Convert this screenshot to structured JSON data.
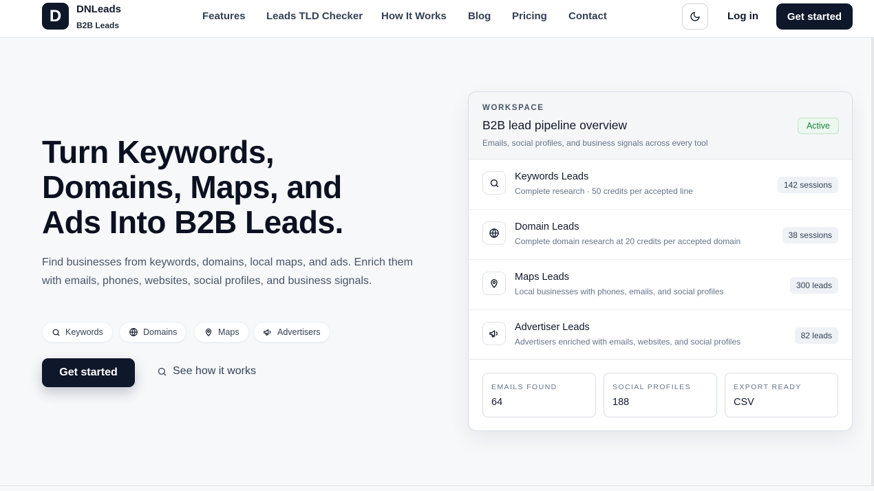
{
  "brand": {
    "logo_letter": "D",
    "name": "DNLeads",
    "tagline": "B2B Leads"
  },
  "nav": {
    "items": [
      "Features",
      "Leads TLD Checker",
      "How It Works",
      "Blog",
      "Pricing",
      "Contact"
    ]
  },
  "header": {
    "theme_icon": "moon-icon",
    "login_label": "Log in",
    "cta_label": "Get started"
  },
  "hero": {
    "title_lines": [
      "Turn Keywords,",
      "Domains, Maps, and",
      "Ads Into B2B Leads."
    ],
    "description": "Find businesses from keywords, domains, local maps, and ads. Enrich them with emails, phones, websites, social profiles, and business signals.",
    "chips": [
      {
        "label": "Keywords",
        "icon": "search-icon"
      },
      {
        "label": "Domains",
        "icon": "globe-icon"
      },
      {
        "label": "Maps",
        "icon": "map-pin-icon"
      },
      {
        "label": "Advertisers",
        "icon": "megaphone-icon"
      }
    ],
    "primary_cta": "Get started",
    "secondary_cta": "See how it works"
  },
  "workspace": {
    "label": "WORKSPACE",
    "title": "B2B lead pipeline overview",
    "status": "Active",
    "subtitle": "Emails, social profiles, and business signals across every tool",
    "tools": [
      {
        "title": "Keywords Leads",
        "subtitle": "Complete research · 50 credits per accepted line",
        "badge": "142 sessions",
        "icon": "search-icon"
      },
      {
        "title": "Domain Leads",
        "subtitle": "Complete domain research at 20 credits per accepted domain",
        "badge": "38 sessions",
        "icon": "globe-icon"
      },
      {
        "title": "Maps Leads",
        "subtitle": "Local businesses with phones, emails, and social profiles",
        "badge": "300 leads",
        "icon": "map-pin-icon"
      },
      {
        "title": "Advertiser Leads",
        "subtitle": "Advertisers enriched with emails, websites, and social profiles",
        "badge": "82 leads",
        "icon": "megaphone-icon"
      }
    ],
    "stats": [
      {
        "label": "EMAILS FOUND",
        "value": "64"
      },
      {
        "label": "SOCIAL PROFILES",
        "value": "188"
      },
      {
        "label": "EXPORT READY",
        "value": "CSV"
      }
    ]
  }
}
